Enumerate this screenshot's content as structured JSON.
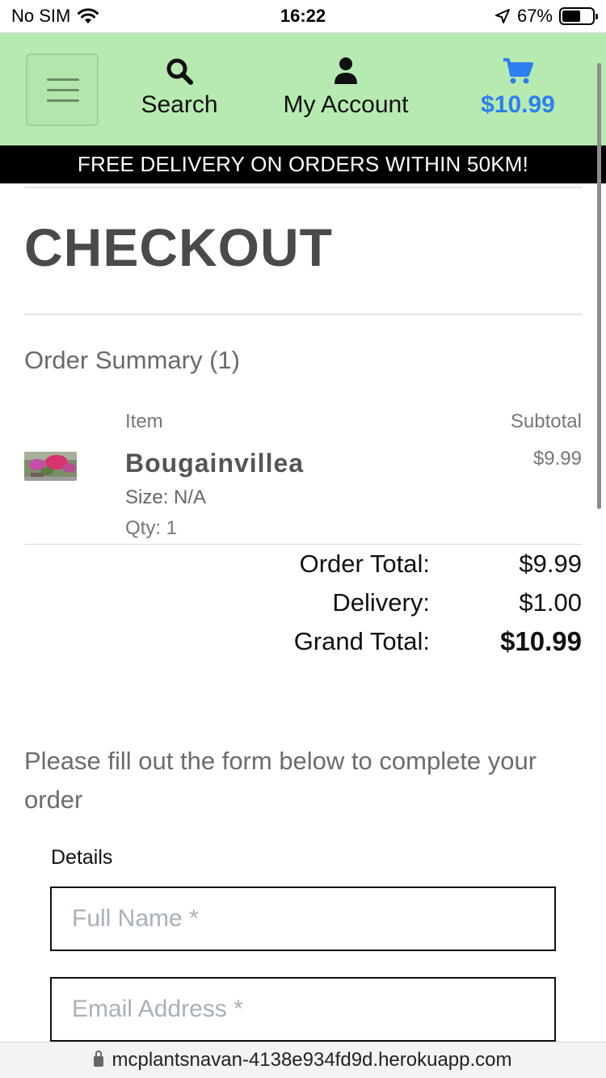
{
  "status_bar": {
    "carrier": "No SIM",
    "time": "16:22",
    "battery": "67%"
  },
  "nav": {
    "search_label": "Search",
    "account_label": "My Account",
    "cart_total": "$10.99",
    "cart_color": "#2d7ff0"
  },
  "banner": {
    "text": "FREE DELIVERY ON ORDERS WITHIN 50KM!"
  },
  "page": {
    "title": "CHECKOUT",
    "summary_title": "Order Summary (1)"
  },
  "order_table": {
    "col_item": "Item",
    "col_subtotal": "Subtotal",
    "items": [
      {
        "name": "Bougainvillea",
        "size": "Size: N/A",
        "qty": "Qty: 1",
        "subtotal": "$9.99"
      }
    ]
  },
  "totals": {
    "order_total_label": "Order Total:",
    "order_total": "$9.99",
    "delivery_label": "Delivery:",
    "delivery": "$1.00",
    "grand_total_label": "Grand Total:",
    "grand_total": "$10.99"
  },
  "form": {
    "intro": "Please fill out the form below to complete your order",
    "details_legend": "Details",
    "full_name_placeholder": "Full Name *",
    "email_placeholder": "Email Address *"
  },
  "browser": {
    "url": "mcplantsnavan-4138e934fd9d.herokuapp.com"
  },
  "colors": {
    "nav_bg": "#b7eab0",
    "banner_bg": "#000000",
    "accent": "#2d7ff0"
  }
}
